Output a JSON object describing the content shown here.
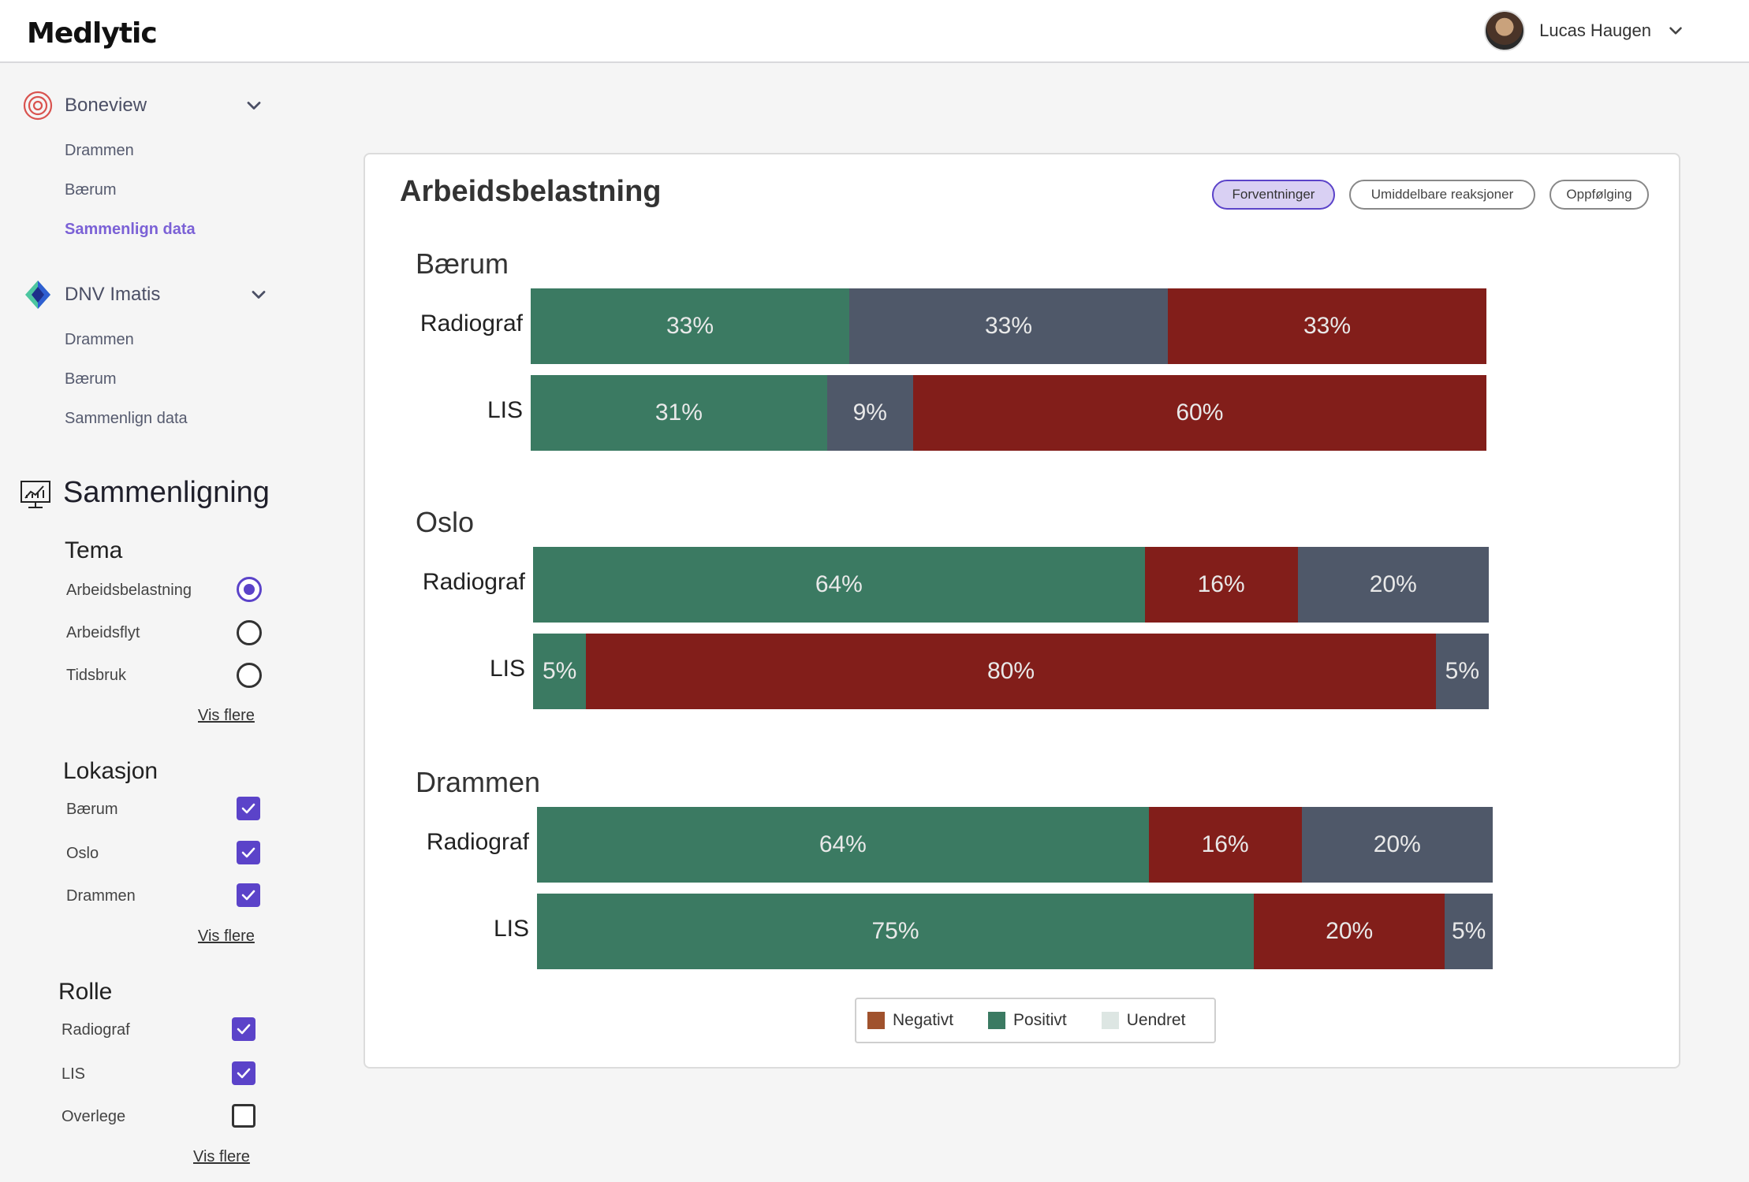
{
  "header": {
    "logo_text": "Medlytic",
    "user_name": "Lucas Haugen"
  },
  "sidebar": {
    "boneview": {
      "label": "Boneview",
      "items": [
        "Drammen",
        "Bærum",
        "Sammenlign data"
      ],
      "active_item": "Sammenlign data"
    },
    "dnv": {
      "label": "DNV Imatis",
      "items": [
        "Drammen",
        "Bærum",
        "Sammenlign data"
      ]
    },
    "compare_title": "Sammenligning",
    "tema": {
      "title": "Tema",
      "options": [
        {
          "label": "Arbeidsbelastning",
          "selected": true
        },
        {
          "label": "Arbeidsflyt",
          "selected": false
        },
        {
          "label": "Tidsbruk",
          "selected": false
        }
      ],
      "more": "Vis flere"
    },
    "lokasjon": {
      "title": "Lokasjon",
      "options": [
        {
          "label": "Bærum",
          "checked": true
        },
        {
          "label": "Oslo",
          "checked": true
        },
        {
          "label": "Drammen",
          "checked": true
        }
      ],
      "more": "Vis flere"
    },
    "rolle": {
      "title": "Rolle",
      "options": [
        {
          "label": "Radiograf",
          "checked": true
        },
        {
          "label": "LIS",
          "checked": true
        },
        {
          "label": "Overlege",
          "checked": false
        }
      ],
      "more": "Vis flere"
    }
  },
  "card": {
    "title": "Arbeidsbelastning",
    "tabs": [
      "Forventninger",
      "Umiddelbare reaksjoner",
      "Oppfølging"
    ],
    "active_tab": "Forventninger"
  },
  "colors": {
    "positive": "#3b7a62",
    "unchanged": "#4f5869",
    "negative": "#821e1a",
    "legend_negative": "#a0522d",
    "legend_positive": "#3b7a62",
    "legend_unchanged": "#dde6e3",
    "accent": "#5b43c9"
  },
  "chart_data": {
    "type": "bar",
    "stacked": true,
    "orientation": "horizontal",
    "groups": [
      {
        "location": "Bærum",
        "rows": [
          {
            "role": "Radiograf",
            "segments": [
              {
                "kind": "positive",
                "value": 33
              },
              {
                "kind": "unchanged",
                "value": 33
              },
              {
                "kind": "negative",
                "value": 33
              }
            ]
          },
          {
            "role": "LIS",
            "segments": [
              {
                "kind": "positive",
                "value": 31
              },
              {
                "kind": "unchanged",
                "value": 9
              },
              {
                "kind": "negative",
                "value": 60
              }
            ]
          }
        ]
      },
      {
        "location": "Oslo",
        "rows": [
          {
            "role": "Radiograf",
            "segments": [
              {
                "kind": "positive",
                "value": 64
              },
              {
                "kind": "negative",
                "value": 16
              },
              {
                "kind": "unchanged",
                "value": 20
              }
            ]
          },
          {
            "role": "LIS",
            "segments": [
              {
                "kind": "positive",
                "value": 5
              },
              {
                "kind": "negative",
                "value": 80
              },
              {
                "kind": "unchanged",
                "value": 5
              }
            ]
          }
        ]
      },
      {
        "location": "Drammen",
        "rows": [
          {
            "role": "Radiograf",
            "segments": [
              {
                "kind": "positive",
                "value": 64
              },
              {
                "kind": "negative",
                "value": 16
              },
              {
                "kind": "unchanged",
                "value": 20
              }
            ]
          },
          {
            "role": "LIS",
            "segments": [
              {
                "kind": "positive",
                "value": 75
              },
              {
                "kind": "negative",
                "value": 20
              },
              {
                "kind": "unchanged",
                "value": 5
              }
            ]
          }
        ]
      }
    ],
    "legend": [
      {
        "label": "Negativt",
        "kind": "legend_negative"
      },
      {
        "label": "Positivt",
        "kind": "legend_positive"
      },
      {
        "label": "Uendret",
        "kind": "legend_unchanged"
      }
    ]
  }
}
